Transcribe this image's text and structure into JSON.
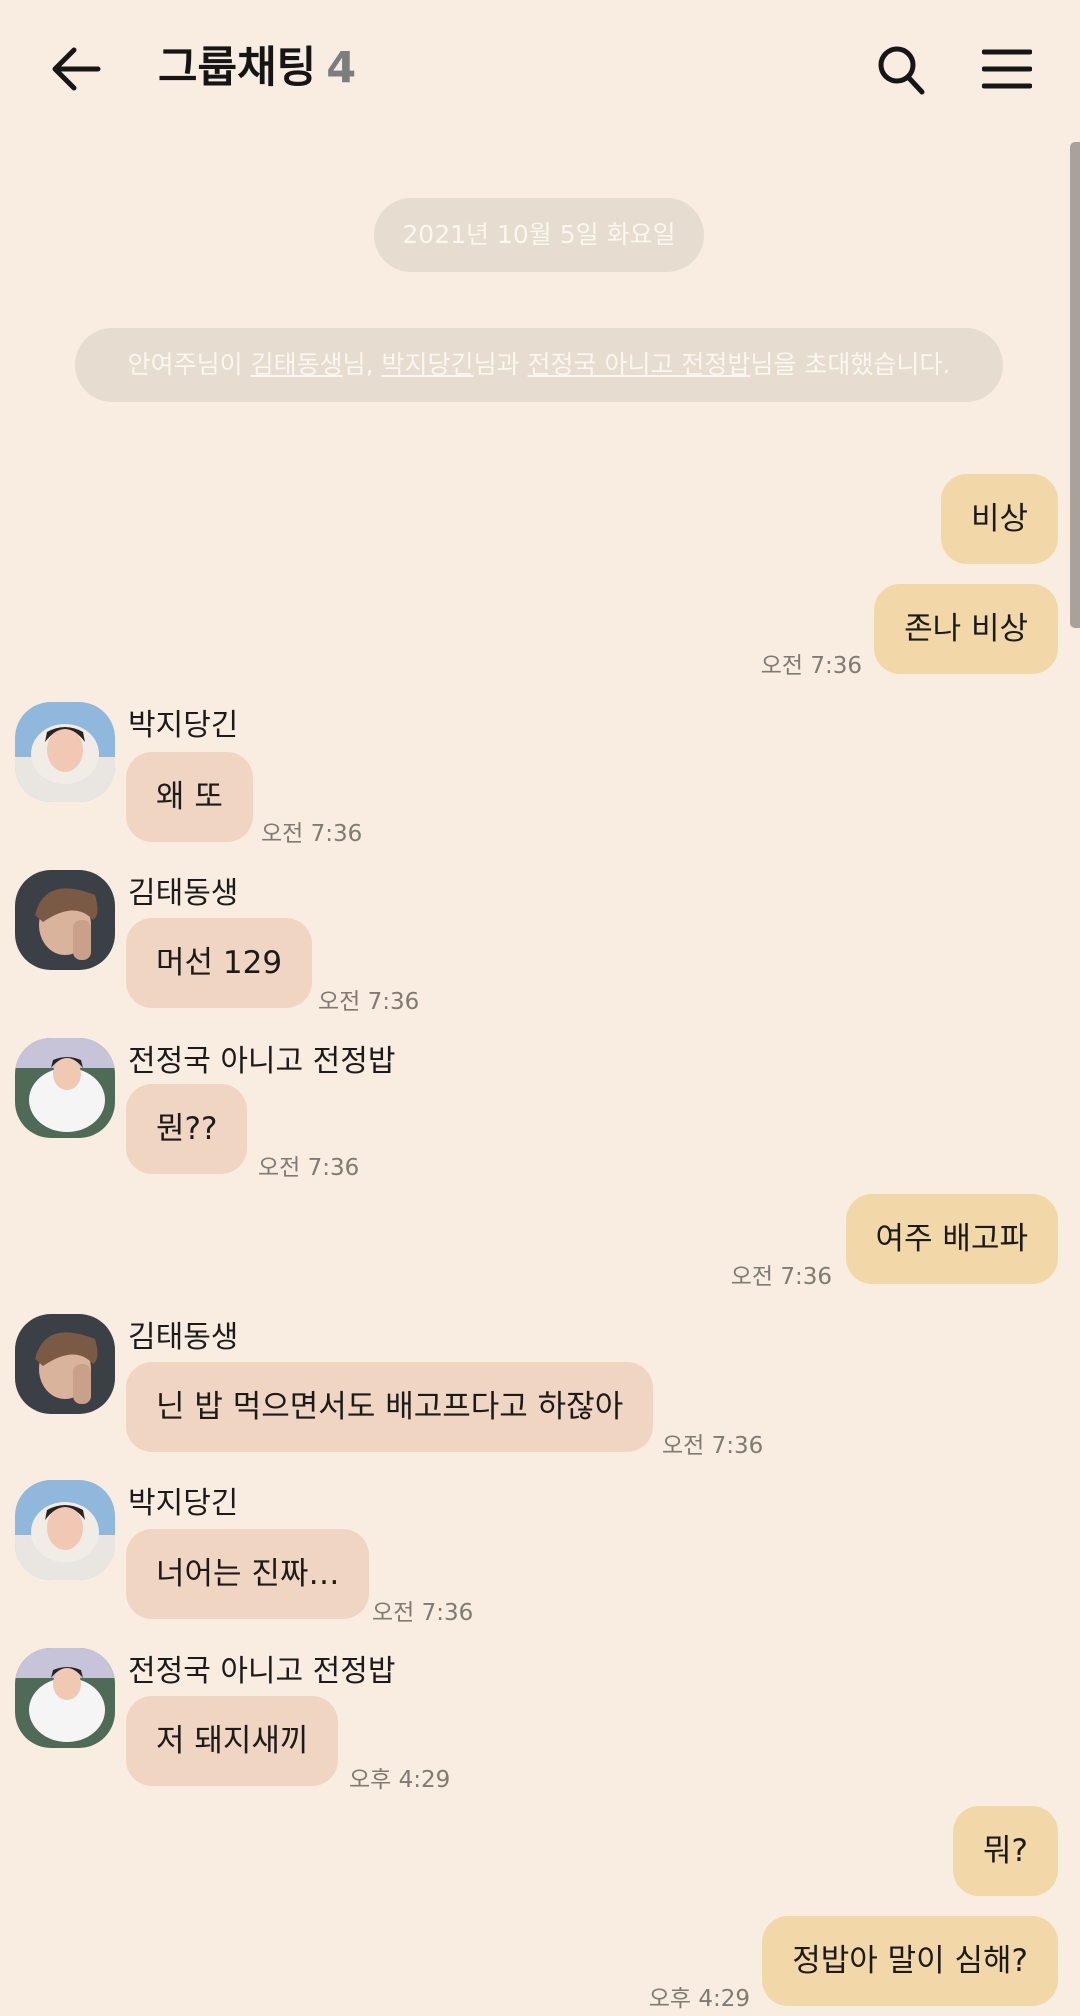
{
  "header": {
    "title": "그룹채팅",
    "member_count": "4",
    "icons": [
      "back-arrow-icon",
      "search-icon",
      "menu-icon"
    ]
  },
  "system": {
    "date": "2021년 10월 5일 화요일",
    "notice": {
      "inviter": "안여주님이 ",
      "invitee1": "김태동생",
      "sep1": "님, ",
      "invitee2": "박지당긴",
      "sep2": "님과 ",
      "invitee3": "전정국 아니고 전정밥",
      "suffix": "님을 초대했습니다."
    }
  },
  "messages": [
    {
      "from": "me",
      "text": "비상"
    },
    {
      "from": "me",
      "text": "존나 비상",
      "time": "오전 7:36"
    },
    {
      "from": "박지당긴",
      "text": "왜 또",
      "time": "오전 7:36"
    },
    {
      "from": "김태동생",
      "text": "머선 129",
      "time": "오전 7:36"
    },
    {
      "from": "전정국 아니고 전정밥",
      "text": "뭔??",
      "time": "오전 7:36"
    },
    {
      "from": "me",
      "text": "여주 배고파",
      "time": "오전 7:36"
    },
    {
      "from": "김태동생",
      "text": "닌 밥 먹으면서도 배고프다고 하잖아",
      "time": "오전 7:36"
    },
    {
      "from": "박지당긴",
      "text": "너어는 진짜…",
      "time": "오전 7:36"
    },
    {
      "from": "전정국 아니고 전정밥",
      "text": "저 돼지새끼",
      "time": "오후 4:29"
    },
    {
      "from": "me",
      "text": "뭐?"
    },
    {
      "from": "me",
      "text": "정밥아 말이 심해?",
      "time": "오후 4:29"
    }
  ],
  "colors": {
    "background": "#f8ede0",
    "my_bubble": "#f2d8a8",
    "their_bubble": "#f0d6c2",
    "system_pill": "#e6dcd0"
  }
}
